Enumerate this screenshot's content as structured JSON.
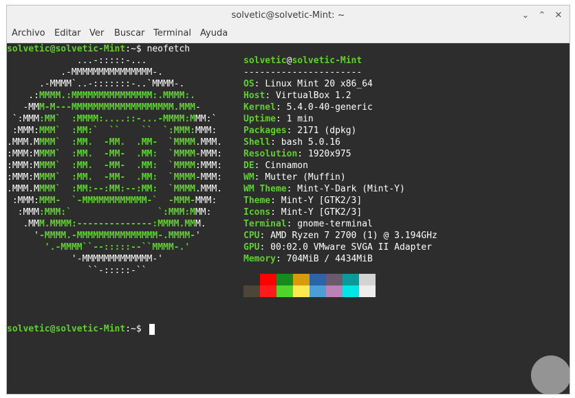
{
  "window": {
    "title": "solvetic@solvetic-Mint: ~",
    "controls": [
      "minimize-icon",
      "maximize-icon",
      "close-icon"
    ]
  },
  "menu": [
    "Archivo",
    "Editar",
    "Ver",
    "Buscar",
    "Terminal",
    "Ayuda"
  ],
  "prompt": {
    "user_host": "solvetic@solvetic-Mint",
    "sep": ":~$",
    "command": "neofetch"
  },
  "art": [
    "             ...-:::::-...",
    "          .-MMMMMMMMMMMMMMM-.",
    "      .-MMMM`..-:::::::-..`MMMM-.",
    "    .:MMMM.:MMMMMMMMMMMMMMM:.MMMM:.",
    "   -MMM-M---MMMMMMMMMMMMMMMMMMM.MMM-",
    " `:MMM:MM`  :MMMM:....::-...-MMMM:MMM:`",
    " :MMM:MMM`  :MM:`  ``    ``  `:MMM:MMM:",
    ".MMM.MMMM`  :MM.  -MM.  .MM-  `MMMM.MMM.",
    ":MMM:MMMM`  :MM.  -MM-  .MM:  `MMMM-MMM:",
    ":MMM:MMMM`  :MM.  -MM-  .MM:  `MMMM:MMM:",
    ":MMM:MMMM`  :MM.  -MM-  .MM:  `MMMM-MMM:",
    ".MMM.MMMM`  :MM:--:MM:--:MM:  `MMMM.MMM.",
    " :MMM:MMM-  `-MMMMMMMMMMMM-`  -MMM-MMM:",
    "  :MMM:MMM:`                `:MMM:MMM:",
    "   .MMM.MMMM:--------------:MMMM.MMM.",
    "     '-MMMM.-MMMMMMMMMMMMMMM-.MMMM-'",
    "       '.-MMMM``--:::::--``MMMM-.'",
    "            '-MMMMMMMMMMMMM-'",
    "               ``-:::::-``"
  ],
  "info": {
    "user": "solvetic",
    "at": "@",
    "host": "solvetic-Mint",
    "divider": "----------------------",
    "rows": [
      {
        "key": "OS",
        "value": "Linux Mint 20 x86_64"
      },
      {
        "key": "Host",
        "value": "VirtualBox 1.2"
      },
      {
        "key": "Kernel",
        "value": "5.4.0-40-generic"
      },
      {
        "key": "Uptime",
        "value": "1 min"
      },
      {
        "key": "Packages",
        "value": "2171 (dpkg)"
      },
      {
        "key": "Shell",
        "value": "bash 5.0.16"
      },
      {
        "key": "Resolution",
        "value": "1920x975"
      },
      {
        "key": "DE",
        "value": "Cinnamon"
      },
      {
        "key": "WM",
        "value": "Mutter (Muffin)"
      },
      {
        "key": "WM Theme",
        "value": "Mint-Y-Dark (Mint-Y)"
      },
      {
        "key": "Theme",
        "value": "Mint-Y [GTK2/3]"
      },
      {
        "key": "Icons",
        "value": "Mint-Y [GTK2/3]"
      },
      {
        "key": "Terminal",
        "value": "gnome-terminal"
      },
      {
        "key": "CPU",
        "value": "AMD Ryzen 7 2700 (1) @ 3.194GHz"
      },
      {
        "key": "GPU",
        "value": "00:02.0 VMware SVGA II Adapter"
      },
      {
        "key": "Memory",
        "value": "704MiB / 4434MiB"
      }
    ]
  },
  "palette_dark": [
    "#2d2d2d",
    "#ff0000",
    "#148a1f",
    "#d89b0c",
    "#2b64a8",
    "#6b5a6e",
    "#0b9a9a",
    "#d3d3d3"
  ],
  "palette_bright": [
    "#4e4539",
    "#ff1b1b",
    "#51d52a",
    "#fce94f",
    "#4aa0d5",
    "#ba82b5",
    "#00e5e5",
    "#eeeeec"
  ],
  "accent": "#5fd12b"
}
